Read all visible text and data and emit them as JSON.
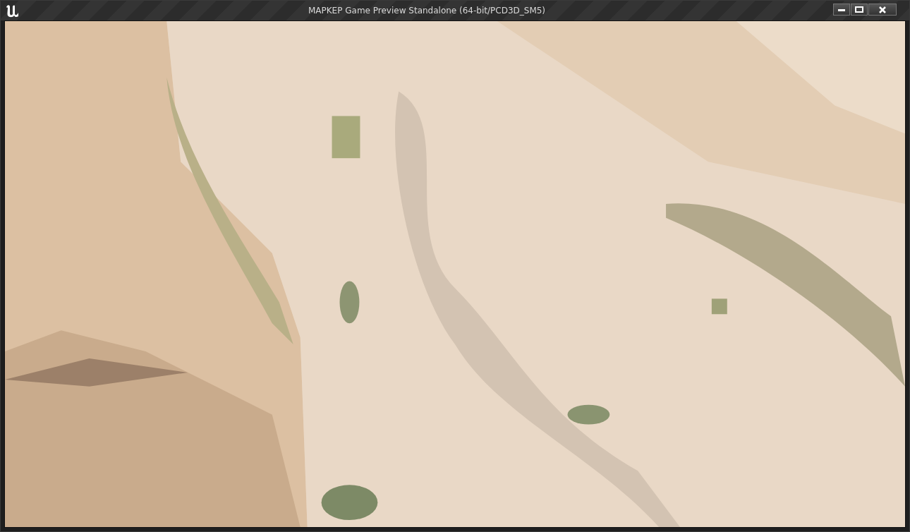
{
  "window": {
    "title": "MAPKEP Game Preview Standalone (64-bit/PCD3D_SM5)"
  }
}
